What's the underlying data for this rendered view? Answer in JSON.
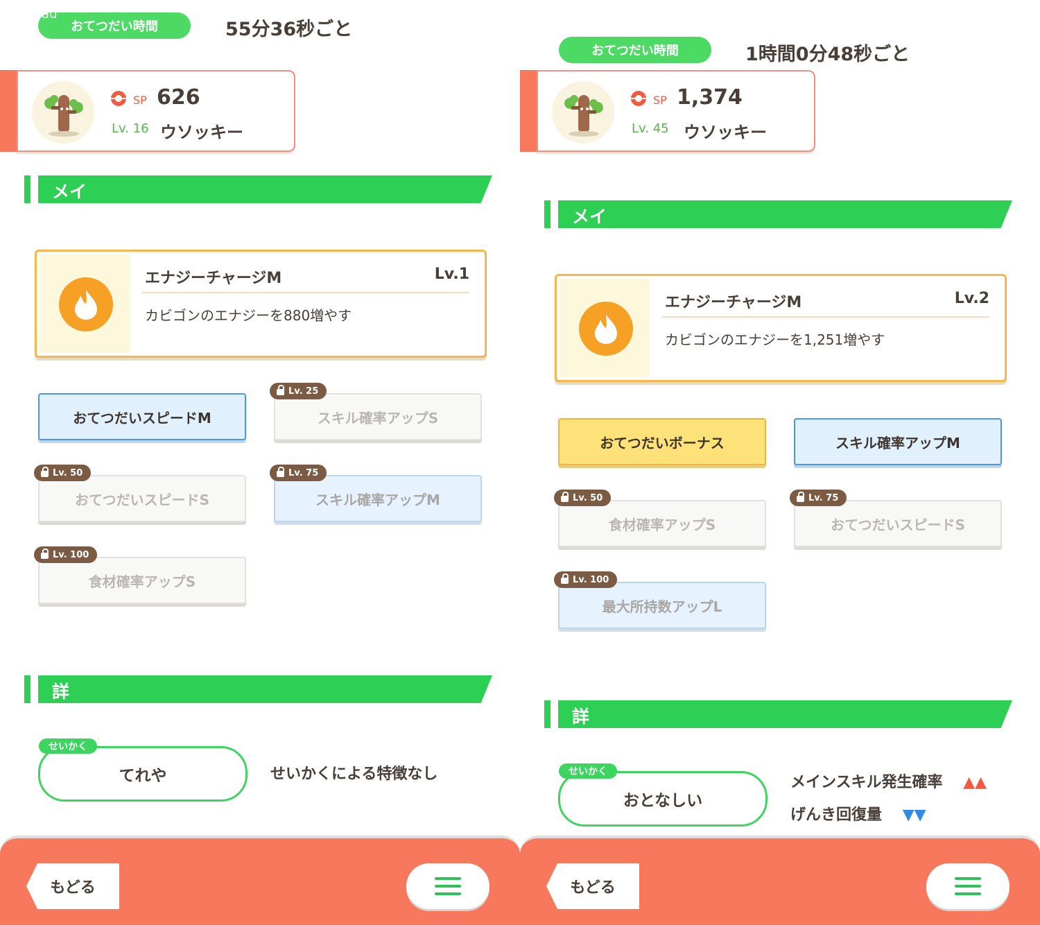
{
  "status_bar": {
    "carrier": "au"
  },
  "left": {
    "help_time": {
      "label": "おてつだい時間",
      "value": "55分36秒ごと"
    },
    "pokemon": {
      "sp_label": "SP",
      "sp": "626",
      "level": "Lv. 16",
      "name": "ウソッキー"
    },
    "skills_header": "メインスキル・サブスキル",
    "main_skill": {
      "name": "エナジーチャージM",
      "level": "Lv.1",
      "description": "カビゴンのエナジーを880増やす"
    },
    "sub_skills": [
      {
        "label": "おてつだいスピードM",
        "lock": "",
        "style": "blue"
      },
      {
        "label": "スキル確率アップS",
        "lock": "Lv. 25",
        "style": "gray"
      },
      {
        "label": "おてつだいスピードS",
        "lock": "Lv. 50",
        "style": "gray"
      },
      {
        "label": "スキル確率アップM",
        "lock": "Lv. 75",
        "style": "blue-dim"
      },
      {
        "label": "食材確率アップS",
        "lock": "Lv. 100",
        "style": "gray"
      }
    ],
    "details_header": "詳細ステータス",
    "nature": {
      "tag": "せいかく",
      "name": "てれや",
      "effect": "せいかくによる特徴なし"
    },
    "back_label": "もどる"
  },
  "right": {
    "help_time": {
      "label": "おてつだい時間",
      "value": "1時間0分48秒ごと"
    },
    "pokemon": {
      "sp_label": "SP",
      "sp": "1,374",
      "level": "Lv. 45",
      "name": "ウソッキー"
    },
    "skills_header": "メインスキル・サブスキル",
    "main_skill": {
      "name": "エナジーチャージM",
      "level": "Lv.2",
      "description": "カビゴンのエナジーを1,251増やす"
    },
    "sub_skills": [
      {
        "label": "おてつだいボーナス",
        "lock": "",
        "style": "gold"
      },
      {
        "label": "スキル確率アップM",
        "lock": "",
        "style": "blue"
      },
      {
        "label": "食材確率アップS",
        "lock": "Lv. 50",
        "style": "gray"
      },
      {
        "label": "おてつだいスピードS",
        "lock": "Lv. 75",
        "style": "gray"
      },
      {
        "label": "最大所持数アップL",
        "lock": "Lv. 100",
        "style": "blue-dim"
      }
    ],
    "details_header": "詳細ステータス",
    "nature": {
      "tag": "せいかく",
      "name": "おとなしい",
      "effects": [
        {
          "label": "メインスキル発生確率",
          "arrows": "▲▲",
          "color": "#f05a40"
        },
        {
          "label": "げんき回復量",
          "arrows": "▼▼",
          "color": "#2e8be6"
        }
      ]
    },
    "back_label": "もどる"
  },
  "colors": {
    "accent_green": "#2dcf55",
    "bottom_bar": "#f8785d",
    "gold_border": "#f7b54a",
    "blue_border": "#4a95e8"
  }
}
